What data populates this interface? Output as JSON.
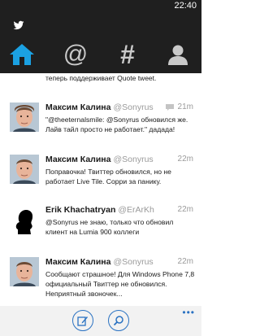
{
  "status_bar": {
    "time": "22:40"
  },
  "tabs": [
    {
      "name": "home",
      "icon": "home-icon",
      "active": true
    },
    {
      "name": "mentions",
      "icon": "at-icon",
      "glyph": "@"
    },
    {
      "name": "hashtags",
      "icon": "hashtag-icon",
      "glyph": "#"
    },
    {
      "name": "profile",
      "icon": "person-icon"
    }
  ],
  "feed": {
    "partial_text": "теперь поддерживает Quote tweet.",
    "tweets": [
      {
        "name": "Максим Калина",
        "handle": "@Sonyrus",
        "time": "21m",
        "reply": true,
        "text": "\"@theeternalsmile: @Sonyrus обновился же. Лайв тайл просто не работает.\" дадада!"
      },
      {
        "name": "Максим Калина",
        "handle": "@Sonyrus",
        "time": "22m",
        "reply": false,
        "text": "Поправочка! Твиттер обновился, но не работает Live Tile. Сорри за панику."
      },
      {
        "name": "Erik Khachatryan",
        "handle": "@ErArKh",
        "time": "22m",
        "reply": false,
        "text": "@Sonyrus не знаю, только что обновил клиент на Lumia 900 коллеги"
      },
      {
        "name": "Максим Калина",
        "handle": "@Sonyrus",
        "time": "22m",
        "reply": false,
        "text": "Сообщают страшное! Для Windows Phone 7,8 официальный Твиттер не обновился. Неприятный звоночек..."
      }
    ]
  },
  "app_bar": {
    "buttons": [
      "compose-icon",
      "search-icon"
    ],
    "more": "•••"
  },
  "colors": {
    "accent": "#2a72c2",
    "top_bg": "#1f1f1f",
    "active_tab": "#1ba1e2"
  }
}
